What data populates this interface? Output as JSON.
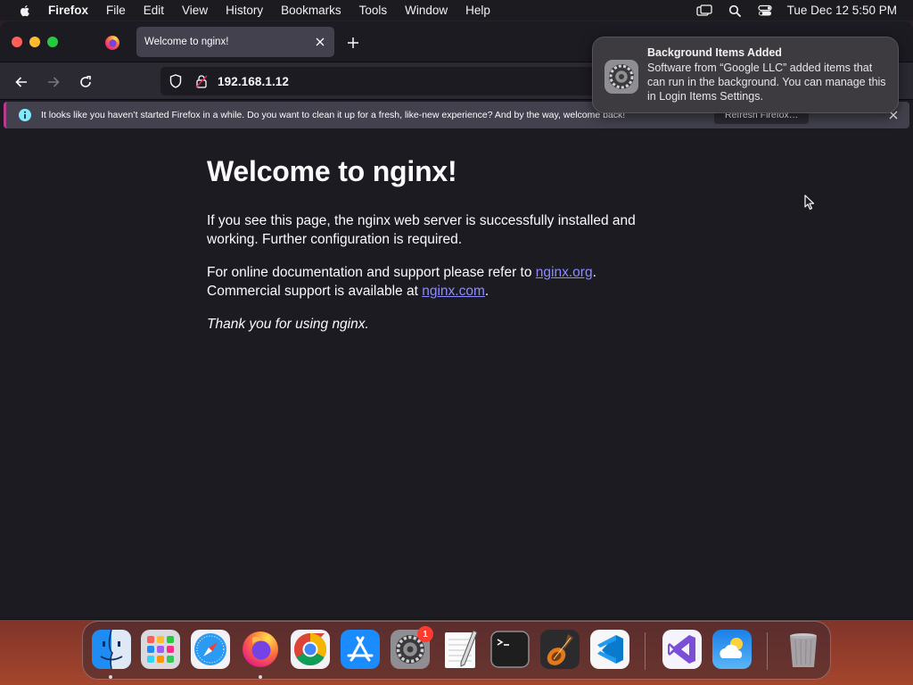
{
  "menubar": {
    "apple_icon": "apple-logo-icon",
    "app_name": "Firefox",
    "items": [
      "File",
      "Edit",
      "View",
      "History",
      "Bookmarks",
      "Tools",
      "Window",
      "Help"
    ],
    "status_icons": [
      "screen-mirroring-icon",
      "spotlight-search-icon",
      "control-center-icon"
    ],
    "clock": "Tue Dec 12  5:50 PM"
  },
  "browser": {
    "tab": {
      "title": "Welcome to nginx!"
    },
    "url": "192.168.1.12",
    "infobar": {
      "message": "It looks like you haven’t started Firefox in a while. Do you want to clean it up for a fresh, like-new experience? And by the way, welcome back!",
      "button": "Refresh Firefox…"
    }
  },
  "page": {
    "heading": "Welcome to nginx!",
    "p1": "If you see this page, the nginx web server is successfully installed and working. Further configuration is required.",
    "p2_prefix": "For online documentation and support please refer to ",
    "p2_link": "nginx.org",
    "p2_mid": ".",
    "p3_prefix": "Commercial support is available at ",
    "p3_link": "nginx.com",
    "p3_suffix": ".",
    "thanks": "Thank you for using nginx."
  },
  "notification": {
    "title": "Background Items Added",
    "body": "Software from “Google LLC” added items that can run in the background. You can manage this in Login Items Settings."
  },
  "dock": {
    "items": [
      "Finder",
      "Launchpad",
      "Safari",
      "Firefox",
      "Google Chrome",
      "App Store",
      "System Settings",
      "TextEdit",
      "Terminal",
      "GarageBand",
      "Visual Studio Code",
      "Visual Studio",
      "Weather",
      "Trash"
    ],
    "system_settings_badge": "1"
  },
  "colors": {
    "link": "#8c8cff",
    "page_bg": "#1c1b22",
    "badge": "#ff3b30"
  }
}
